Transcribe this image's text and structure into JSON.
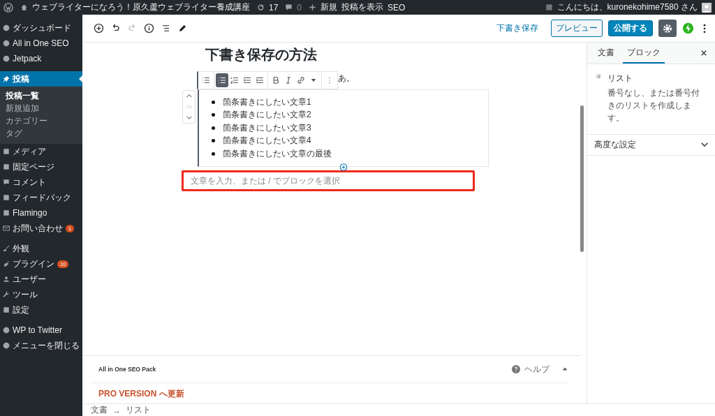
{
  "admin_bar": {
    "site_name": "ウェブライターになろう！原久蘆ウェブライター養成講座",
    "updates": "17",
    "comments": "0",
    "new_label": "新規",
    "links": [
      "投稿を表示",
      "SEO"
    ],
    "greeting": "こんにちは、kuronekohime7580 さん"
  },
  "sidebar": {
    "groups": [
      [
        {
          "label": "ダッシュボード",
          "selected": false
        },
        {
          "label": "All in One SEO",
          "selected": false
        },
        {
          "label": "Jetpack",
          "selected": false
        }
      ],
      [
        {
          "label": "投稿",
          "selected": true,
          "children": [
            {
              "label": "投稿一覧",
              "selected": true
            },
            {
              "label": "新規追加",
              "selected": false
            },
            {
              "label": "カテゴリー",
              "selected": false
            },
            {
              "label": "タグ",
              "selected": false
            }
          ]
        },
        {
          "label": "メディア",
          "selected": false
        },
        {
          "label": "固定ページ",
          "selected": false
        },
        {
          "label": "コメント",
          "selected": false
        },
        {
          "label": "フィードバック",
          "selected": false
        },
        {
          "label": "Flamingo",
          "selected": false
        },
        {
          "label": "お問い合わせ",
          "selected": false,
          "badge": "1"
        }
      ],
      [
        {
          "label": "外観",
          "selected": false
        },
        {
          "label": "プラグイン",
          "selected": false,
          "badge": "10"
        },
        {
          "label": "ユーザー",
          "selected": false
        },
        {
          "label": "ツール",
          "selected": false
        },
        {
          "label": "設定",
          "selected": false
        }
      ],
      [
        {
          "label": "WP to Twitter",
          "selected": false
        },
        {
          "label": "メニューを閉じる",
          "selected": false
        }
      ]
    ]
  },
  "header": {
    "save_draft": "下書き保存",
    "preview": "プレビュー",
    "publish": "公開する"
  },
  "editor": {
    "title": "下書き保存の方法",
    "paragraph_tail": "あ。",
    "list_toolbar": [
      {
        "kind": "switcher"
      },
      {
        "kind": "unordered",
        "selected": true
      },
      {
        "kind": "ordered",
        "selected": false
      },
      {
        "kind": "outdent",
        "selected": false
      },
      {
        "kind": "indent",
        "selected": false
      },
      {
        "kind": "bold"
      },
      {
        "kind": "italic"
      },
      {
        "kind": "link"
      },
      {
        "kind": "more"
      },
      {
        "kind": "options"
      }
    ],
    "list_items": [
      "箇条書きにしたい文章1",
      "箇条書きにしたい文章2",
      "箇条書きにしたい文章3",
      "箇条書きにしたい文章4",
      "箇条書きにしたい文章の最後"
    ],
    "new_paragraph": {
      "placeholder": "文章を入力、または / でブロックを選択"
    }
  },
  "meta_box": {
    "title": "All in One SEO Pack",
    "help": "ヘルプ",
    "expanded": true,
    "pro_link": "PRO VERSION へ更新"
  },
  "breadcrumb": [
    "文書",
    "→",
    "リスト"
  ],
  "settings_panel": {
    "tabs": [
      {
        "label": "文書",
        "selected": false
      },
      {
        "label": "ブロック",
        "selected": true
      }
    ],
    "block_name": "リスト",
    "block_description": "番号なし、または番号付きのリストを作成します。",
    "sections": [
      {
        "label": "高度な設定",
        "expanded": false
      }
    ]
  }
}
